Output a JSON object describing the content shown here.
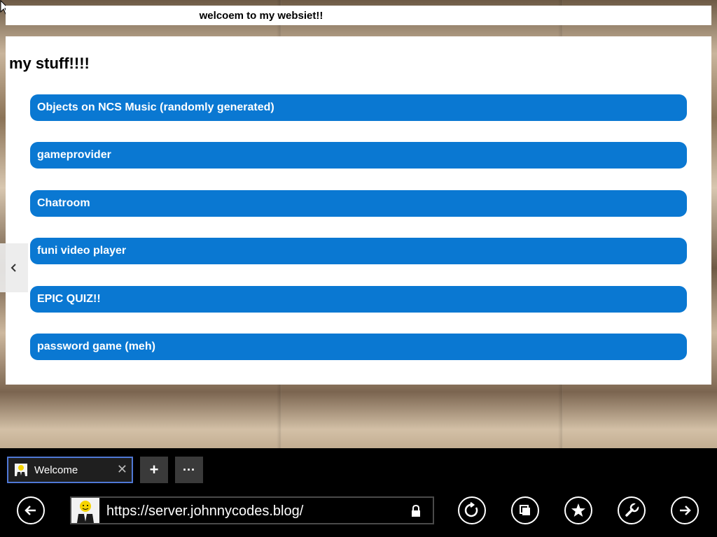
{
  "header": {
    "title": "welcoem to my websiet!!"
  },
  "main": {
    "heading": "my stuff!!!!",
    "links": [
      {
        "label": "Objects on NCS Music (randomly generated)"
      },
      {
        "label": "gameprovider"
      },
      {
        "label": "Chatroom"
      },
      {
        "label": "funi video player"
      },
      {
        "label": "EPIC QUIZ!!"
      },
      {
        "label": "password game (meh)"
      }
    ]
  },
  "browser": {
    "tab": {
      "label": "Welcome",
      "close_glyph": "✕"
    },
    "new_tab_glyph": "+",
    "more_glyph": "···",
    "address": {
      "url": "https://server.johnnycodes.blog/"
    },
    "icons": [
      "back-arrow-icon",
      "refresh-icon",
      "tabs-icon",
      "favorites-star-icon",
      "tools-wrench-icon",
      "forward-arrow-icon",
      "lock-icon"
    ]
  },
  "colors": {
    "link_button": "#0a78d2",
    "tab_border": "#4f78d6",
    "chrome_bg": "#000000"
  }
}
